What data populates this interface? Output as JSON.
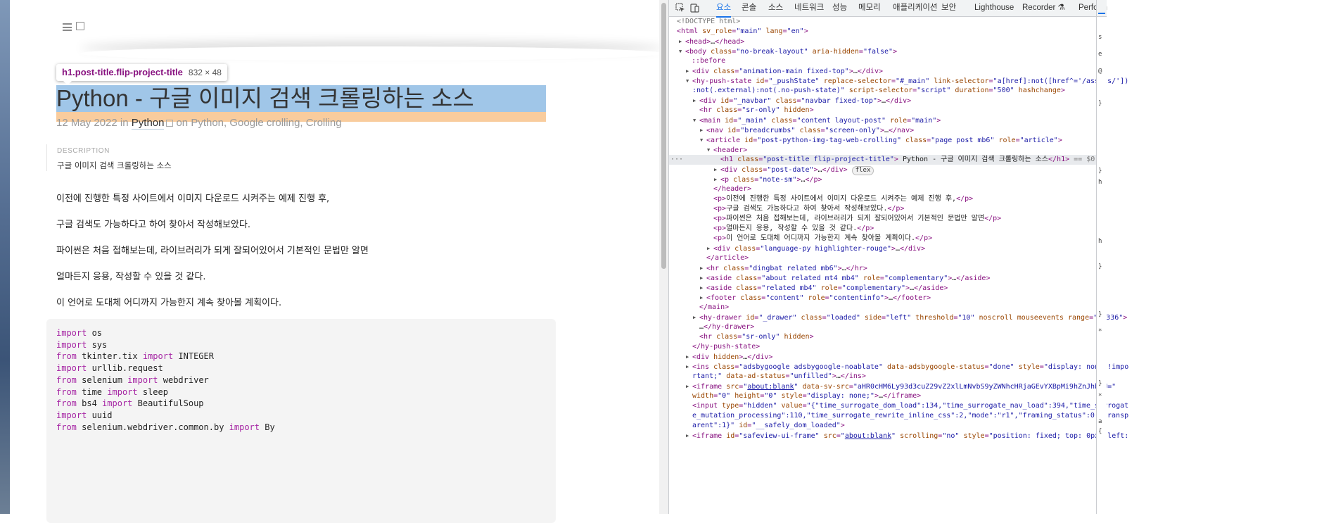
{
  "page": {
    "title": "Python - 구글 이미지 검색 크롤링하는 소스",
    "date": "12 May 2022",
    "date_in": "in",
    "category": "Python",
    "tags_text": "on Python, Google crolling, Crolling",
    "description_label": "DESCRIPTION",
    "description_text": "구글 이미지 검색 크롤링하는 소스",
    "paragraphs": [
      "이전에 진행한 특정 사이트에서 이미지 다운로드 시켜주는 예제 진행 후,",
      "구글 검색도 가능하다고 하여 찾아서 작성해보았다.",
      "파이썬은 처음 접해보는데, 라이브러리가 되게 잘되어있어서 기본적인 문법만 알면",
      "얼마든지 응용, 작성할 수 있을 것 같다.",
      "이 언어로 도대체 어디까지 가능한지 계속 찾아볼 계획이다."
    ],
    "code_lines": [
      {
        "k1": "import",
        "t1": " os",
        "k2": "",
        "t2": ""
      },
      {
        "k1": "import",
        "t1": " sys",
        "k2": "",
        "t2": ""
      },
      {
        "k1": "from",
        "t1": " tkinter.tix ",
        "k2": "import",
        "t2": " INTEGER"
      },
      {
        "k1": "import",
        "t1": " urllib.request",
        "k2": "",
        "t2": ""
      },
      {
        "k1": "from",
        "t1": " selenium ",
        "k2": "import",
        "t2": " webdriver"
      },
      {
        "k1": "from",
        "t1": " time ",
        "k2": "import",
        "t2": " sleep"
      },
      {
        "k1": "from",
        "t1": " bs4 ",
        "k2": "import",
        "t2": " BeautifulSoup"
      },
      {
        "k1": "import",
        "t1": " uuid",
        "k2": "",
        "t2": ""
      },
      {
        "k1": "from",
        "t1": " selenium.webdriver.common.by ",
        "k2": "import",
        "t2": " By"
      }
    ]
  },
  "tooltip": {
    "selector": "h1.post-title.flip-project-title",
    "size": "832 × 48"
  },
  "devtools": {
    "tabs": [
      "요소",
      "콘솔",
      "소스",
      "네트워크",
      "성능",
      "메모리",
      "애플리케이션",
      "보안",
      "Lighthouse",
      "Recorder",
      "Perform"
    ],
    "active_tab": "요소",
    "side_glyphs": [
      "s",
      "e",
      "@",
      "}",
      "}",
      "h",
      "h",
      "}",
      "}",
      "*",
      "}",
      "*",
      "a",
      "{"
    ]
  },
  "colors": {
    "accent": "#1a73e8",
    "tag": "#881280",
    "attr_name": "#994500",
    "attr_value": "#1a1aa6",
    "highlight_content": "#6fa8dc",
    "highlight_margin": "#f6b26b"
  }
}
